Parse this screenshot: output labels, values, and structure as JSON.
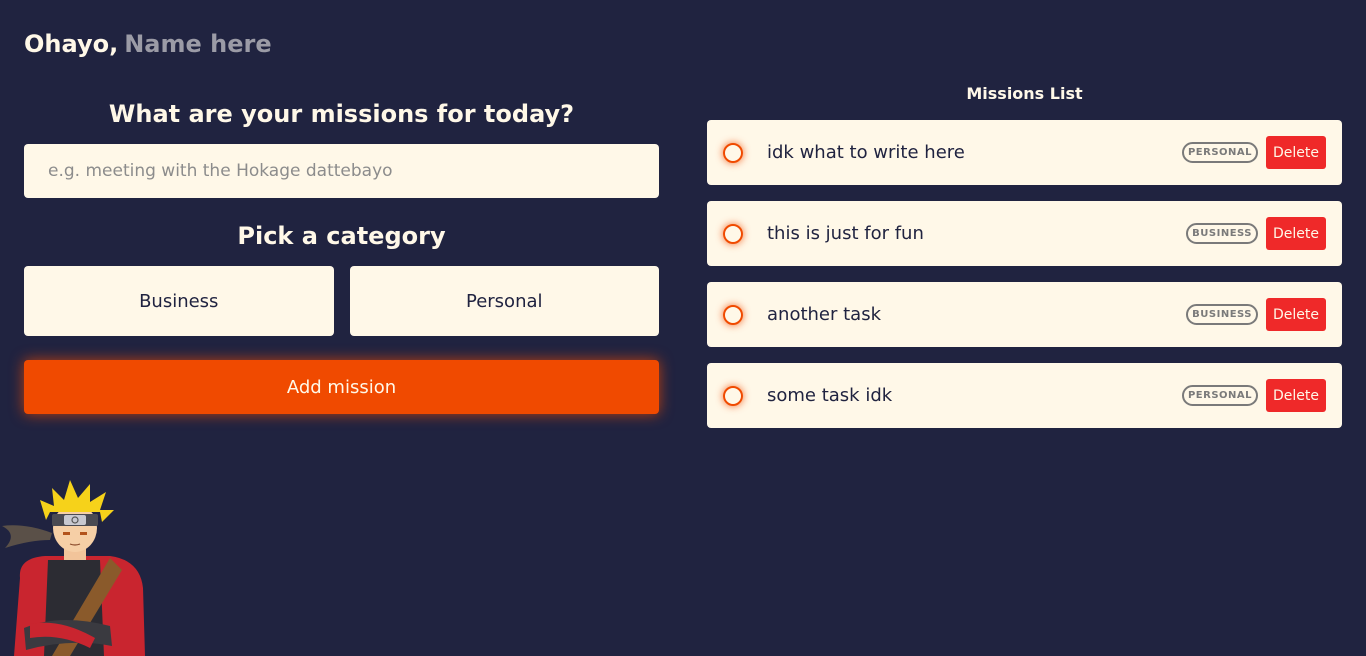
{
  "greeting": {
    "prefix": "Ohayo,",
    "name_placeholder": "Name here"
  },
  "form": {
    "heading": "What are your missions for today?",
    "input_placeholder": "e.g. meeting with the Hokage dattebayo",
    "category_heading": "Pick a category",
    "categories": [
      "Business",
      "Personal"
    ],
    "add_button": "Add mission"
  },
  "list": {
    "title": "Missions List",
    "delete_label": "Delete",
    "tasks": [
      {
        "text": "idk what to write here",
        "category": "PERSONAL"
      },
      {
        "text": "this is just for fun",
        "category": "BUSINESS"
      },
      {
        "text": "another task",
        "category": "BUSINESS"
      },
      {
        "text": "some task idk",
        "category": "PERSONAL"
      }
    ]
  },
  "colors": {
    "background": "#202340",
    "card": "#fff8e8",
    "accent": "#f04a00",
    "delete": "#ef2929"
  },
  "icons": {
    "avatar": "naruto-character-illustration"
  }
}
